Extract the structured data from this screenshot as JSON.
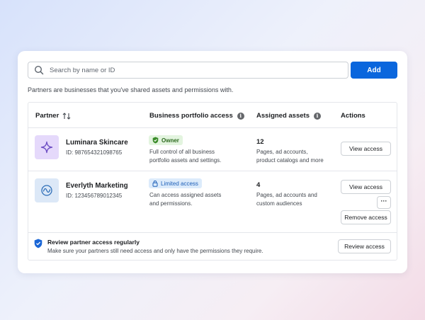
{
  "search": {
    "placeholder": "Search by name or ID",
    "value": ""
  },
  "add_label": "Add",
  "intro_text": "Partners are businesses that you've shared assets and permissions with.",
  "columns": {
    "partner": "Partner",
    "access": "Business portfolio access",
    "assets": "Assigned assets",
    "actions": "Actions"
  },
  "partners": [
    {
      "name": "Luminara Skincare",
      "id": "ID: 987654321098765",
      "badge": "Owner",
      "access_desc_1": "Full control of all business",
      "access_desc_2": "portfolio assets and settings.",
      "asset_count": "12",
      "assets_desc_1": "Pages, ad accounts,",
      "assets_desc_2": "product catalogs and more",
      "action": "View access",
      "logo_icon": "sparkle-icon"
    },
    {
      "name": "Everlyth Marketing",
      "id": "ID: 123456789012345",
      "badge": "Limited access",
      "access_desc_1": "Can access assigned assets",
      "access_desc_2": "and permissions.",
      "asset_count": "4",
      "assets_desc_1": "Pages, ad accounts and",
      "assets_desc_2": "custom audiences",
      "action": "View access",
      "more": "···",
      "remove": "Remove access",
      "logo_icon": "wave-circle-icon"
    }
  ],
  "review": {
    "title": "Review partner access regularly",
    "desc": "Make sure your partners still need access and only have the permissions they require.",
    "button": "Review access"
  },
  "colors": {
    "primary": "#0a66dd",
    "owner_badge_bg": "#e3f4df",
    "limited_badge_bg": "#dcebfb",
    "sparkle_logo_bg": "#e5d9fb",
    "wave_logo_bg": "#dce8f7"
  }
}
